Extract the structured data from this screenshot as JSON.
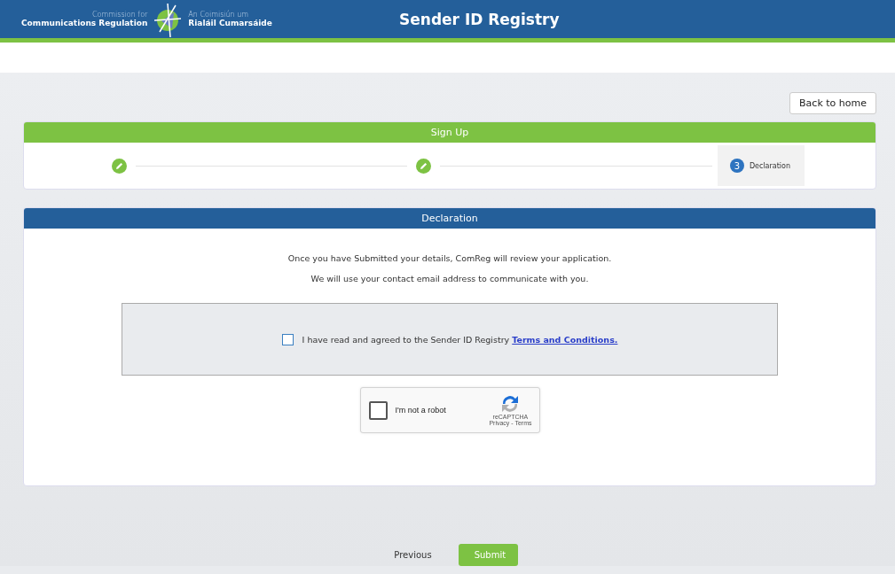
{
  "header": {
    "logo_en_small": "Commission for",
    "logo_en_bold": "Communications Regulation",
    "logo_ga_small": "An Coimisiún um",
    "logo_ga_bold": "Rialáil Cumarsáide",
    "title": "Sender ID Registry"
  },
  "back_button": "Back to home",
  "signup": {
    "title": "Sign Up",
    "steps": [
      {
        "completed": true,
        "selected": false
      },
      {
        "completed": true,
        "selected": false
      },
      {
        "number": "3",
        "label": "Declaration",
        "completed": false,
        "selected": true
      }
    ]
  },
  "declaration": {
    "title": "Declaration",
    "paragraphs": [
      "Once you have Submitted your details, ComReg will review your application.",
      "We will use your contact email address to communicate with you."
    ],
    "agreement": {
      "text": "I have read and agreed to the Sender ID Registry",
      "link": "Terms and Conditions.",
      "checked": false
    },
    "captcha": {
      "label": "I'm not a robot",
      "brand": "reCAPTCHA",
      "links": "Privacy - Terms",
      "checked": false
    }
  },
  "footer_buttons": [
    {
      "kind": "link",
      "label": "Previous"
    },
    {
      "kind": "primary",
      "label": "Submit"
    }
  ]
}
